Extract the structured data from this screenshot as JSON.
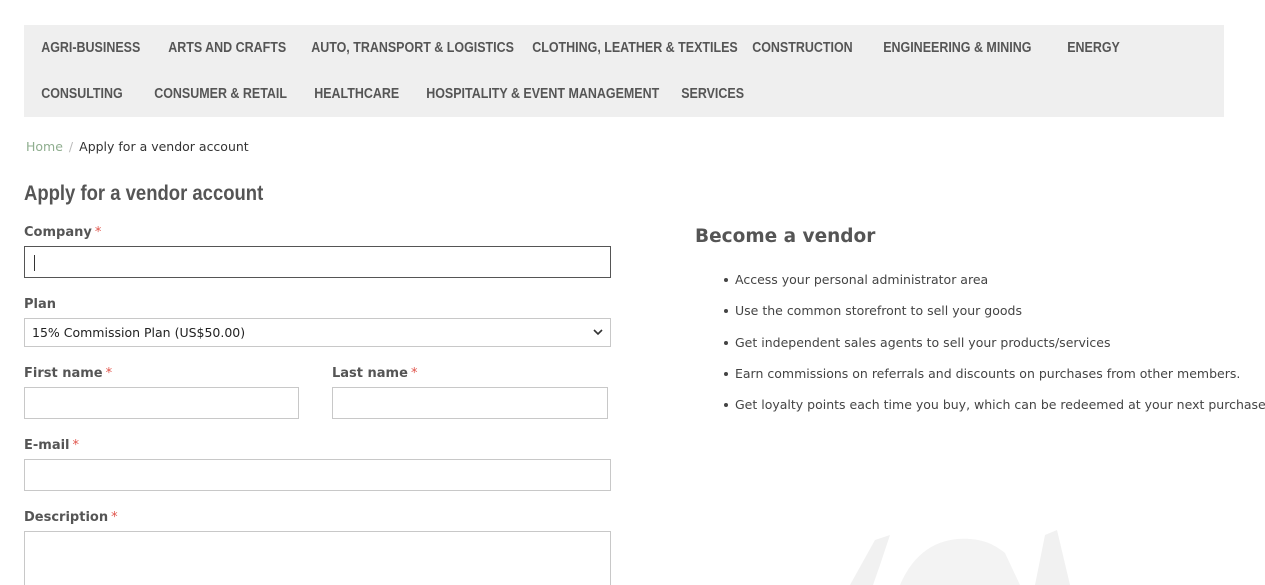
{
  "nav": {
    "row1": [
      "AGRI-BUSINESS",
      "ARTS AND CRAFTS",
      "AUTO, TRANSPORT & LOGISTICS",
      "CLOTHING, LEATHER & TEXTILES",
      "CONSTRUCTION",
      "ENGINEERING & MINING",
      "ENERGY"
    ],
    "row2": [
      "CONSULTING",
      "CONSUMER & RETAIL",
      "HEALTHCARE",
      "HOSPITALITY & EVENT MANAGEMENT",
      "SERVICES"
    ]
  },
  "breadcrumb": {
    "home": "Home",
    "separator": "/",
    "current": "Apply for a vendor account"
  },
  "form": {
    "title": "Apply for a vendor account",
    "required_mark": "*",
    "company": {
      "label": "Company",
      "value": ""
    },
    "plan": {
      "label": "Plan",
      "selected": "15% Commission Plan (US$50.00)"
    },
    "first_name": {
      "label": "First name",
      "value": ""
    },
    "last_name": {
      "label": "Last name",
      "value": ""
    },
    "email": {
      "label": "E-mail",
      "value": ""
    },
    "description": {
      "label": "Description",
      "value": ""
    }
  },
  "vendor": {
    "title": "Become a vendor",
    "benefits": [
      "Access your personal administrator area",
      "Use the common storefront to sell your goods",
      "Get independent sales agents to sell your products/services",
      "Earn commissions on referrals and discounts on purchases from other members.",
      "Get loyalty points each time you buy, which can be redeemed at your next purchase"
    ]
  },
  "colors": {
    "nav_bg": "#efefef",
    "required": "#e0534a",
    "link": "#8fae8f"
  }
}
